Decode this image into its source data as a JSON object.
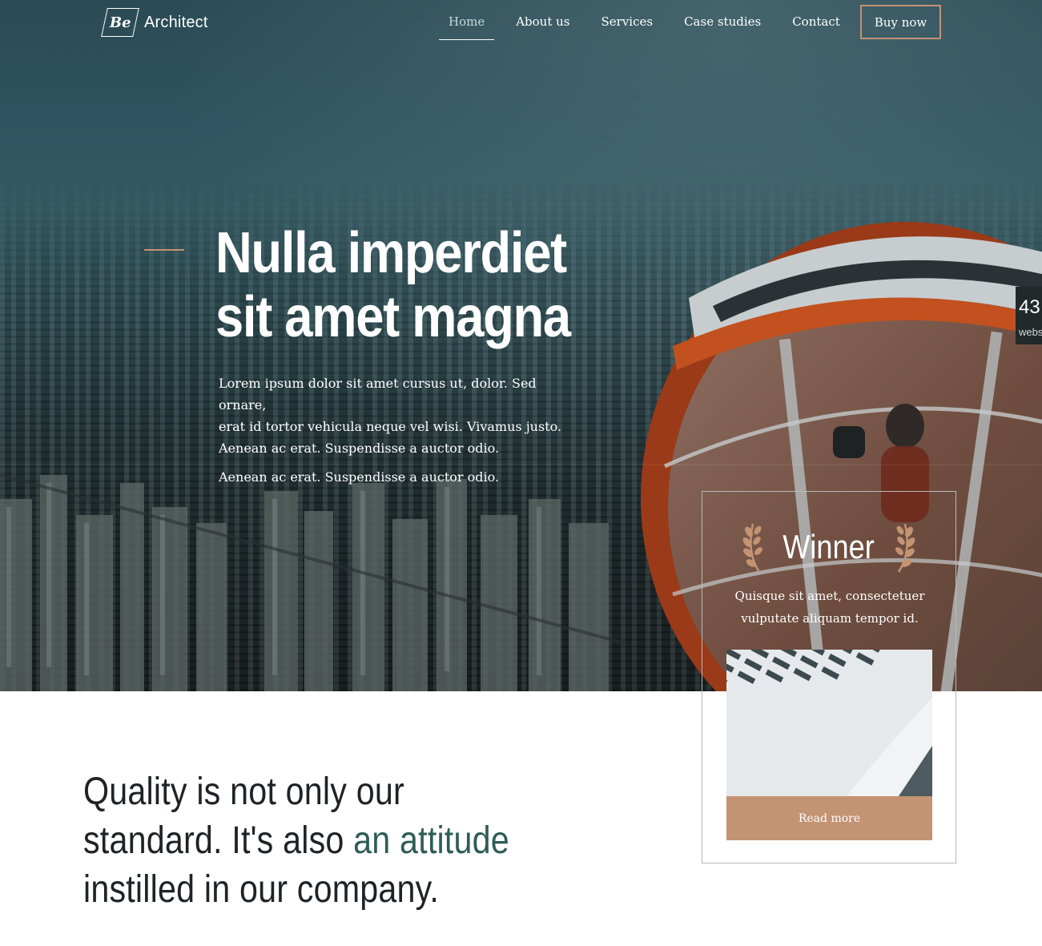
{
  "brand": {
    "logo_mark": "Be",
    "name": "Architect"
  },
  "nav": {
    "items": [
      "Home",
      "About us",
      "Services",
      "Case studies",
      "Contact"
    ],
    "active": "Home",
    "buy_label": "Buy now"
  },
  "hero": {
    "title_line1": "Nulla imperdiet",
    "title_line2": "sit amet magna",
    "lead_line1": "Lorem ipsum dolor sit amet cursus ut, dolor. Sed ornare,",
    "lead_line2": "erat id tortor vehicula neque vel wisi. Vivamus justo.",
    "lead_line3": "Aenean ac erat. Suspendisse a auctor odio.",
    "lead_line4": "Aenean ac erat. Suspendisse a auctor odio."
  },
  "side_badge": {
    "number": "43",
    "label": "webs"
  },
  "winner_card": {
    "title": "Winner",
    "text_line1": "Quisque sit amet, consectetuer",
    "text_line2": "vulputate aliquam tempor id.",
    "button": "Read more",
    "icon": "laurel-icon"
  },
  "quality": {
    "line1": "Quality is not only our",
    "line2_start": "standard. It's also ",
    "line2_accent": "an attitude",
    "line3": "instilled in our company."
  },
  "colors": {
    "accent": "#c39373",
    "heading_accent": "#2e5c56",
    "heading": "#1e2327"
  }
}
